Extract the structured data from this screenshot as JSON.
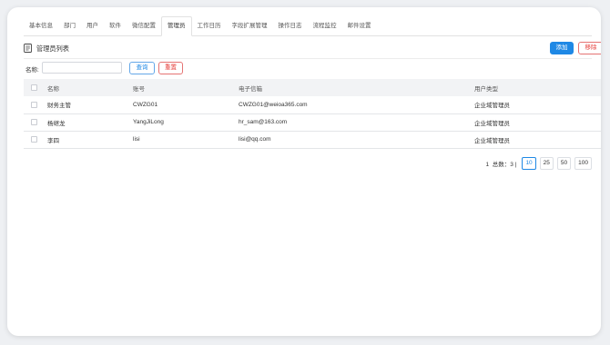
{
  "tabs": [
    "基本信息",
    "部门",
    "用户",
    "软件",
    "微信配置",
    "管理员",
    "工作日历",
    "字段扩展管理",
    "操作日志",
    "流程监控",
    "邮件设置"
  ],
  "active_tab": 5,
  "page_title": "管理员列表",
  "buttons": {
    "add": "添加",
    "remove": "移除",
    "query": "查询",
    "reset": "重置"
  },
  "search": {
    "label": "名称",
    "value": ""
  },
  "table": {
    "columns": [
      "名称",
      "账号",
      "电子信箱",
      "用户类型"
    ],
    "rows": [
      [
        "财务主管",
        "CWZG01",
        "CWZG01@weioa365.com",
        "企业域管理员"
      ],
      [
        "杨继龙",
        "YangJiLong",
        "hr_sam@163.com",
        "企业域管理员"
      ],
      [
        "李四",
        "lisi",
        "lisi@qq.com",
        "企业域管理员"
      ]
    ]
  },
  "pagination": {
    "current_page": "1",
    "total_text": "总数：3",
    "separator": "|",
    "page_sizes": [
      "10",
      "25",
      "50",
      "100"
    ],
    "selected_size": "10"
  },
  "colors": {
    "primary": "#1e88e5",
    "danger": "#e53935"
  }
}
